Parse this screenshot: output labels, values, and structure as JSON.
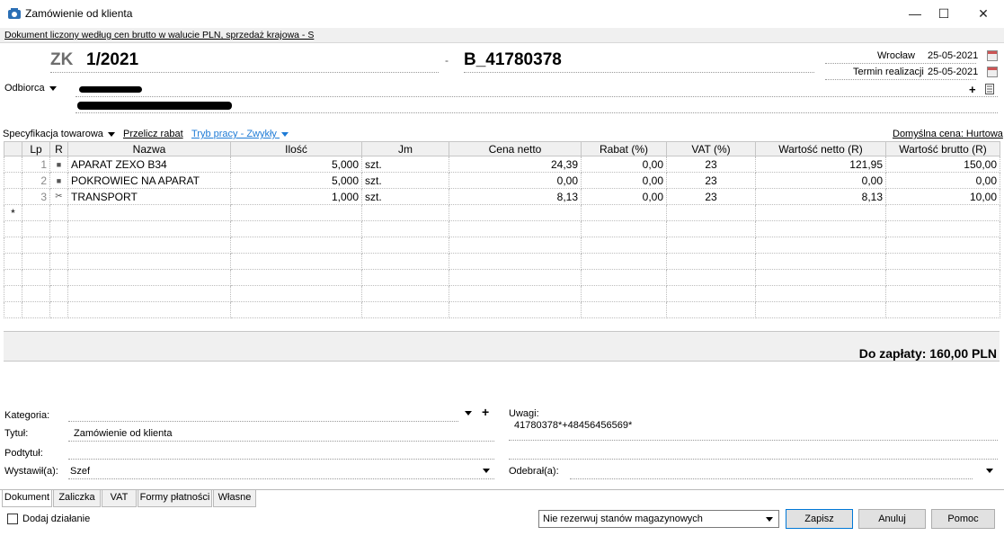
{
  "window": {
    "title": "Zamówienie od klienta",
    "minimize": "—",
    "maximize": "☐",
    "close": "✕"
  },
  "info_bar": "Dokument liczony według cen brutto w walucie PLN, sprzedaż krajowa - S",
  "header": {
    "doc_type": "ZK",
    "doc_number": "1/2021",
    "separator": "-",
    "foreign_number": "B_41780378",
    "city": "Wrocław",
    "date": "25-05-2021",
    "term_label": "Termin realizacji",
    "term_date": "25-05-2021",
    "recipient_label": "Odbiorca",
    "add_symbol": "+"
  },
  "toolbar": {
    "spec_label": "Specyfikacja towarowa",
    "recalc_label": "Przelicz rabat",
    "mode_label": "Tryb pracy - Zwykły",
    "default_price": "Domyślna cena: Hurtowa"
  },
  "table": {
    "columns": [
      "Lp",
      "R",
      "Nazwa",
      "Ilość",
      "Jm",
      "Cena netto",
      "Rabat (%)",
      "VAT (%)",
      "Wartość netto (R)",
      "Wartość brutto (R)"
    ],
    "rows": [
      {
        "lp": "1",
        "r": "■",
        "name": "APARAT ZEXO B34",
        "qty": "5,000",
        "unit": "szt.",
        "net": "24,39",
        "disc": "0,00",
        "vat": "23",
        "net_val": "121,95",
        "gross_val": "150,00"
      },
      {
        "lp": "2",
        "r": "■",
        "name": "POKROWIEC NA APARAT",
        "qty": "5,000",
        "unit": "szt.",
        "net": "0,00",
        "disc": "0,00",
        "vat": "23",
        "net_val": "0,00",
        "gross_val": "0,00"
      },
      {
        "lp": "3",
        "r": "✂",
        "name": "TRANSPORT",
        "qty": "1,000",
        "unit": "szt.",
        "net": "8,13",
        "disc": "0,00",
        "vat": "23",
        "net_val": "8,13",
        "gross_val": "10,00"
      }
    ],
    "new_row_marker": "*"
  },
  "total": "Do zapłaty: 160,00 PLN",
  "form": {
    "category_label": "Kategoria:",
    "title_label": "Tytuł:",
    "title_value": "Zamówienie od klienta",
    "subtitle_label": "Podtytuł:",
    "issued_label": "Wystawił(a):",
    "issued_value": "Szef",
    "notes_label": "Uwagi:",
    "notes_value": "41780378*+48456456569*",
    "received_label": "Odebrał(a):",
    "add_symbol": "+"
  },
  "tabs": [
    "Dokument",
    "Zaliczka",
    "VAT",
    "Formy płatności",
    "Własne"
  ],
  "footer": {
    "add_action": "Dodaj działanie",
    "reservation_select": "Nie rezerwuj stanów magazynowych",
    "save": "Zapisz",
    "cancel": "Anuluj",
    "help": "Pomoc"
  }
}
